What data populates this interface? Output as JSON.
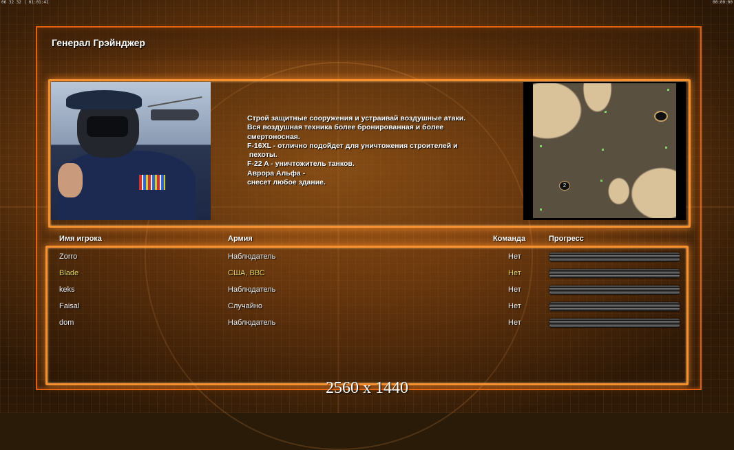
{
  "topbar": {
    "left": "06 32 32 | 01:01:41",
    "right": "00:00:00"
  },
  "general": {
    "title": "Генерал Грэйнджер",
    "description": [
      "Строй защитные сооружения и устраивай воздушные атаки.",
      "Вся воздушная техника более бронированная и более",
      "смертоносная.",
      "F-16XL - отлично подойдет для уничтожения строителей и",
      " пехоты.",
      "F-22 A - уничтожитель танков.",
      "Аврора Альфа -",
      "снесет любое здание."
    ]
  },
  "minimap": {
    "start_marker": "2"
  },
  "table": {
    "headers": {
      "name": "Имя игрока",
      "army": "Армия",
      "team": "Команда",
      "progress": "Прогресс"
    },
    "rows": [
      {
        "name": "Zorro",
        "army": "Наблюдатель",
        "team": "Нет",
        "progress": 0
      },
      {
        "name": "Blade",
        "army": "США, ВВС",
        "team": "Нет",
        "progress": 0
      },
      {
        "name": "keks",
        "army": "Наблюдатель",
        "team": "Нет",
        "progress": 0
      },
      {
        "name": "Faisal",
        "army": "Случайно",
        "team": "Нет",
        "progress": 0
      },
      {
        "name": "dom",
        "army": "Наблюдатель",
        "team": "Нет",
        "progress": 0
      }
    ]
  },
  "resolution": "2560 x 1440",
  "colors": {
    "accent": "#ff9632",
    "highlight_row": "#e6d86a"
  }
}
